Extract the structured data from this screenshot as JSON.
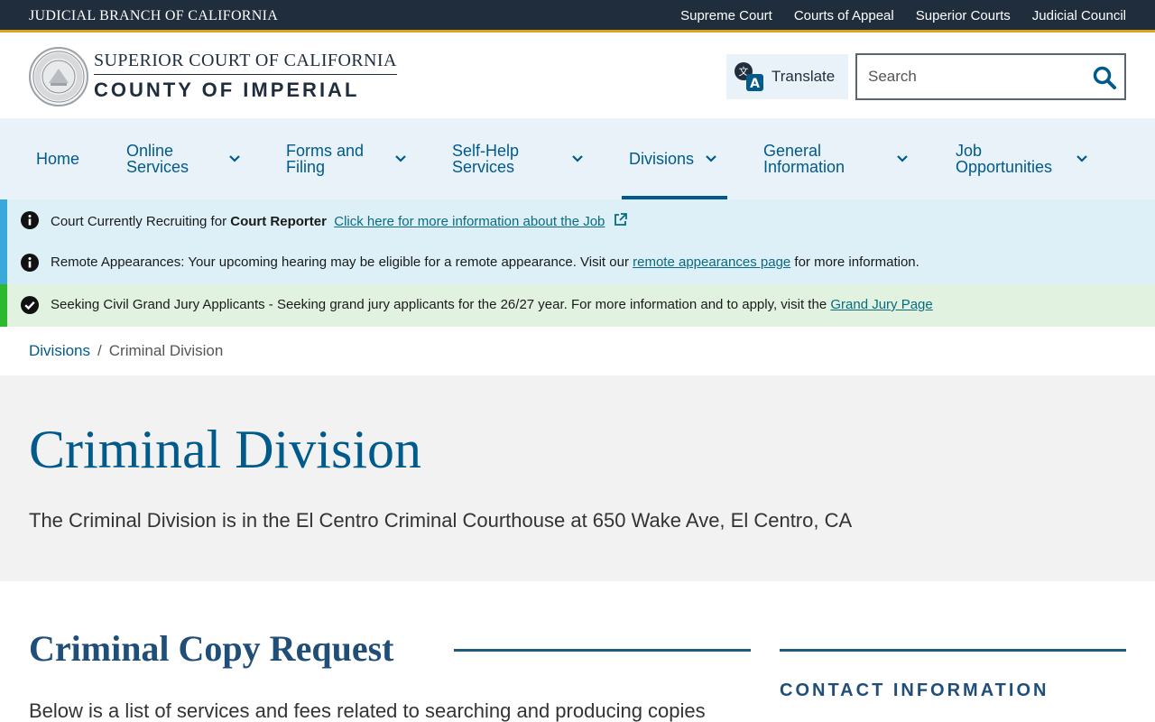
{
  "topbar": {
    "brand": "JUDICIAL BRANCH OF CALIFORNIA",
    "links": [
      "Supreme Court",
      "Courts of Appeal",
      "Superior Courts",
      "Judicial Council"
    ]
  },
  "header": {
    "line1": "SUPERIOR COURT OF CALIFORNIA",
    "line2": "COUNTY OF IMPERIAL",
    "translate_label": "Translate",
    "search_placeholder": "Search"
  },
  "nav": {
    "items": [
      {
        "label": "Home"
      },
      {
        "label": "Online Services"
      },
      {
        "label": "Forms and Filing"
      },
      {
        "label": "Self-Help Services"
      },
      {
        "label": "Divisions"
      },
      {
        "label": "General Information"
      },
      {
        "label": "Job Opportunities"
      }
    ]
  },
  "alerts": [
    {
      "prefix": "Court Currently Recruiting for ",
      "bold": "Court Reporter",
      "link": "Click here for more information about the Job"
    },
    {
      "text": "Remote Appearances: Your upcoming hearing may be eligible for a remote appearance. Visit our ",
      "link": "remote appearances page",
      "suffix": " for more information."
    },
    {
      "text": "Seeking Civil Grand Jury Applicants - Seeking grand jury applicants for the 26/27 year. For more information and to apply, visit the ",
      "link": "Grand Jury Page"
    }
  ],
  "breadcrumb": {
    "parent": "Divisions",
    "separator": "/",
    "current": "Criminal Division"
  },
  "hero": {
    "title": "Criminal Division",
    "description": "The Criminal Division is in the El Centro Criminal Courthouse at 650 Wake Ave, El Centro, CA"
  },
  "main": {
    "section_title": "Criminal Copy Request",
    "section_body": "Below is a list of services and fees related to searching and producing copies"
  },
  "aside": {
    "title": "CONTACT INFORMATION"
  },
  "colors": {
    "topbar": "#1f2d3d",
    "accent_gold": "#d9a520",
    "link_blue": "#005a8c",
    "nav_bg": "#e8f2f8",
    "alert_info": "#ddf0f7",
    "alert_success": "#e1f3e0"
  }
}
